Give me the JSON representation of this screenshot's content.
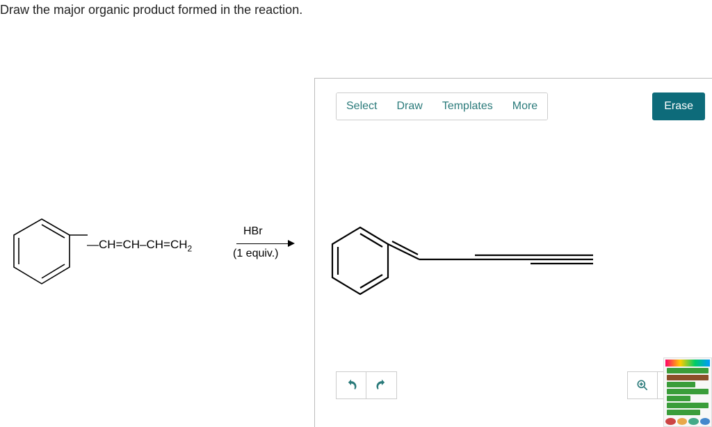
{
  "question": "Draw the major organic product formed in the reaction.",
  "reagent": {
    "top": "HBr",
    "bottom": "(1 equiv.)"
  },
  "substituent_text": "—CH=CH–CH=CH",
  "substituent_sub": "2",
  "toolbar": {
    "tabs": [
      "Select",
      "Draw",
      "Templates",
      "More"
    ],
    "erase": "Erase"
  },
  "controls": {
    "undo": "↶",
    "redo": "↷",
    "zoom_in": "⊕",
    "zoom_reset": "⤺"
  }
}
